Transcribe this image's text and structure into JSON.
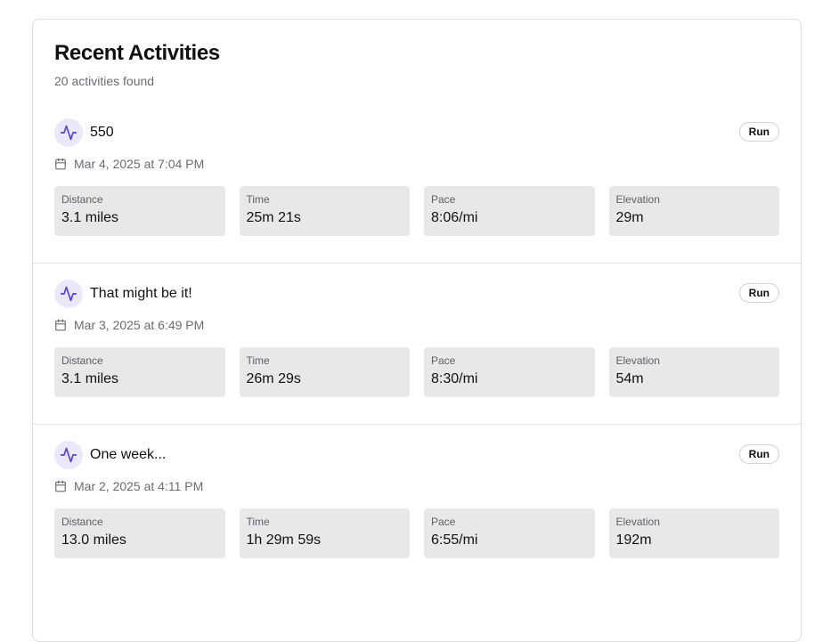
{
  "header": {
    "title": "Recent Activities",
    "subtitle": "20 activities found"
  },
  "icons": {
    "activity": "activity-pulse-icon",
    "calendar": "calendar-icon"
  },
  "colors": {
    "accent": "#5b3fd6",
    "icon_bg": "#ece8fb",
    "stat_bg": "#e8e8e8"
  },
  "activities": [
    {
      "name": "550",
      "type": "Run",
      "date": "Mar 4, 2025 at 7:04 PM",
      "stats": [
        {
          "label": "Distance",
          "value": "3.1 miles"
        },
        {
          "label": "Time",
          "value": "25m 21s"
        },
        {
          "label": "Pace",
          "value": "8:06/mi"
        },
        {
          "label": "Elevation",
          "value": "29m"
        }
      ]
    },
    {
      "name": "That might be it!",
      "type": "Run",
      "date": "Mar 3, 2025 at 6:49 PM",
      "stats": [
        {
          "label": "Distance",
          "value": "3.1 miles"
        },
        {
          "label": "Time",
          "value": "26m 29s"
        },
        {
          "label": "Pace",
          "value": "8:30/mi"
        },
        {
          "label": "Elevation",
          "value": "54m"
        }
      ]
    },
    {
      "name": "One week...",
      "type": "Run",
      "date": "Mar 2, 2025 at 4:11 PM",
      "stats": [
        {
          "label": "Distance",
          "value": "13.0 miles"
        },
        {
          "label": "Time",
          "value": "1h 29m 59s"
        },
        {
          "label": "Pace",
          "value": "6:55/mi"
        },
        {
          "label": "Elevation",
          "value": "192m"
        }
      ]
    }
  ]
}
